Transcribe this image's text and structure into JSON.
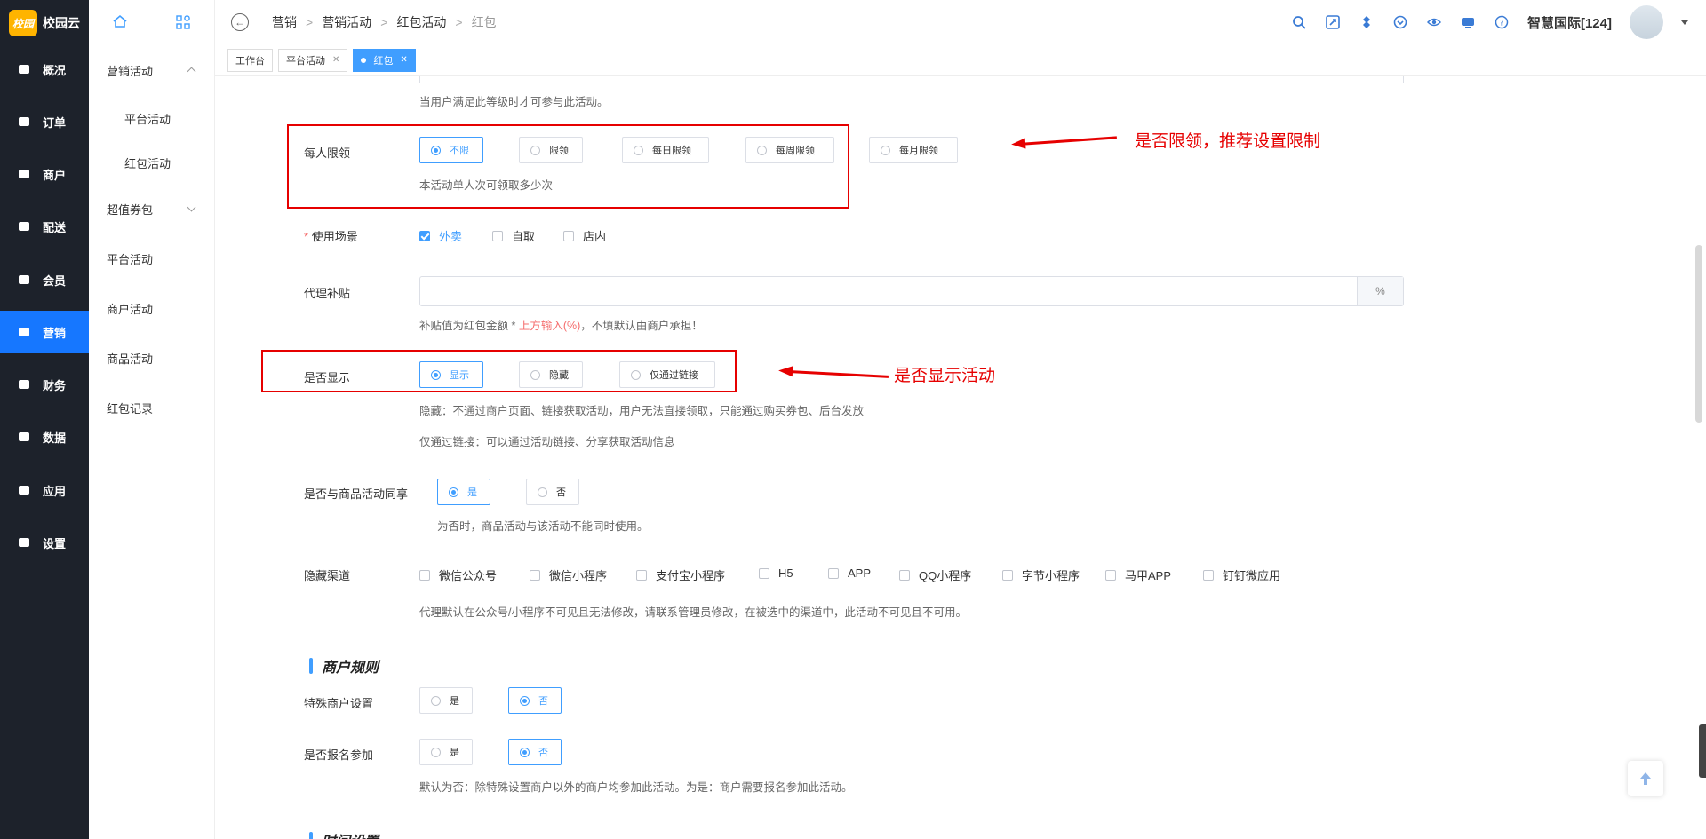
{
  "app": {
    "logo_badge": "校园",
    "logo_name": "校园云"
  },
  "leftnav": [
    {
      "label": "概况",
      "icon": "dashboard-icon"
    },
    {
      "label": "订单",
      "icon": "order-icon"
    },
    {
      "label": "商户",
      "icon": "shop-icon"
    },
    {
      "label": "配送",
      "icon": "delivery-icon"
    },
    {
      "label": "会员",
      "icon": "member-icon"
    },
    {
      "label": "营销",
      "icon": "marketing-icon",
      "active": true
    },
    {
      "label": "财务",
      "icon": "finance-icon"
    },
    {
      "label": "数据",
      "icon": "data-icon"
    },
    {
      "label": "应用",
      "icon": "app-icon"
    },
    {
      "label": "设置",
      "icon": "settings-icon"
    }
  ],
  "subnav": {
    "items": [
      {
        "label": "营销活动",
        "expanded": true
      },
      {
        "label": "平台活动",
        "child": true
      },
      {
        "label": "红包活动",
        "child": true
      },
      {
        "label": "超值券包",
        "expanded": false
      },
      {
        "label": "平台活动"
      },
      {
        "label": "商户活动"
      },
      {
        "label": "商品活动"
      },
      {
        "label": "红包记录"
      }
    ]
  },
  "header": {
    "breadcrumb": [
      "营销",
      "营销活动",
      "红包活动",
      "红包"
    ],
    "user_name": "智慧国际[124]",
    "icons": [
      "search-icon",
      "fullscreen-icon",
      "refresh-icon",
      "download-icon",
      "eye-icon",
      "monitor-icon",
      "help-icon"
    ]
  },
  "tabs": [
    {
      "label": "工作台",
      "closable": false
    },
    {
      "label": "平台活动",
      "closable": true
    },
    {
      "label": "红包",
      "closable": true,
      "active": true
    }
  ],
  "form": {
    "level_hint": "当用户满足此等级时才可参与此活动。",
    "limit": {
      "label": "每人限领",
      "options": [
        "不限",
        "限领",
        "每日限领",
        "每周限领",
        "每月限领"
      ],
      "selected": "不限",
      "hint": "本活动单人次可领取多少次"
    },
    "scene": {
      "required_mark": "*",
      "label": "使用场景",
      "options": [
        {
          "label": "外卖",
          "checked": true
        },
        {
          "label": "自取",
          "checked": false
        },
        {
          "label": "店内",
          "checked": false
        }
      ]
    },
    "subsidy": {
      "label": "代理补贴",
      "value": "",
      "suffix": "%",
      "hint_prefix": "补贴值为红包金额 * ",
      "hint_highlight": "上方输入(%)",
      "hint_suffix": "，不填默认由商户承担！"
    },
    "display": {
      "label": "是否显示",
      "options": [
        "显示",
        "隐藏",
        "仅通过链接"
      ],
      "selected": "显示",
      "hint1": "隐藏：不通过商户页面、链接获取活动，用户无法直接领取，只能通过购买券包、后台发放",
      "hint2": "仅通过链接：可以通过活动链接、分享获取活动信息"
    },
    "share": {
      "label": "是否与商品活动同享",
      "options": [
        "是",
        "否"
      ],
      "selected": "是",
      "hint": "为否时，商品活动与该活动不能同时使用。"
    },
    "hidden_channels": {
      "label": "隐藏渠道",
      "options": [
        "微信公众号",
        "微信小程序",
        "支付宝小程序",
        "H5",
        "APP",
        "QQ小程序",
        "字节小程序",
        "马甲APP",
        "钉钉微应用"
      ],
      "hint": "代理默认在公众号/小程序不可见且无法修改，请联系管理员修改，在被选中的渠道中，此活动不可见且不可用。"
    },
    "merchant_rules": {
      "title": "商户规则",
      "special": {
        "label": "特殊商户设置",
        "options": [
          "是",
          "否"
        ],
        "selected": "否"
      },
      "signup": {
        "label": "是否报名参加",
        "options": [
          "是",
          "否"
        ],
        "selected": "否",
        "hint": "默认为否：除特殊设置商户以外的商户均参加此活动。为是：商户需要报名参加此活动。"
      }
    },
    "time_settings_title": "时间设置"
  },
  "annotations": {
    "limit_note": "是否限领，推荐设置限制",
    "display_note": "是否显示活动"
  },
  "colors": {
    "primary": "#409eff",
    "nav_bg": "#1d222b",
    "nav_active": "#1677ff",
    "annotation": "#e60000"
  }
}
